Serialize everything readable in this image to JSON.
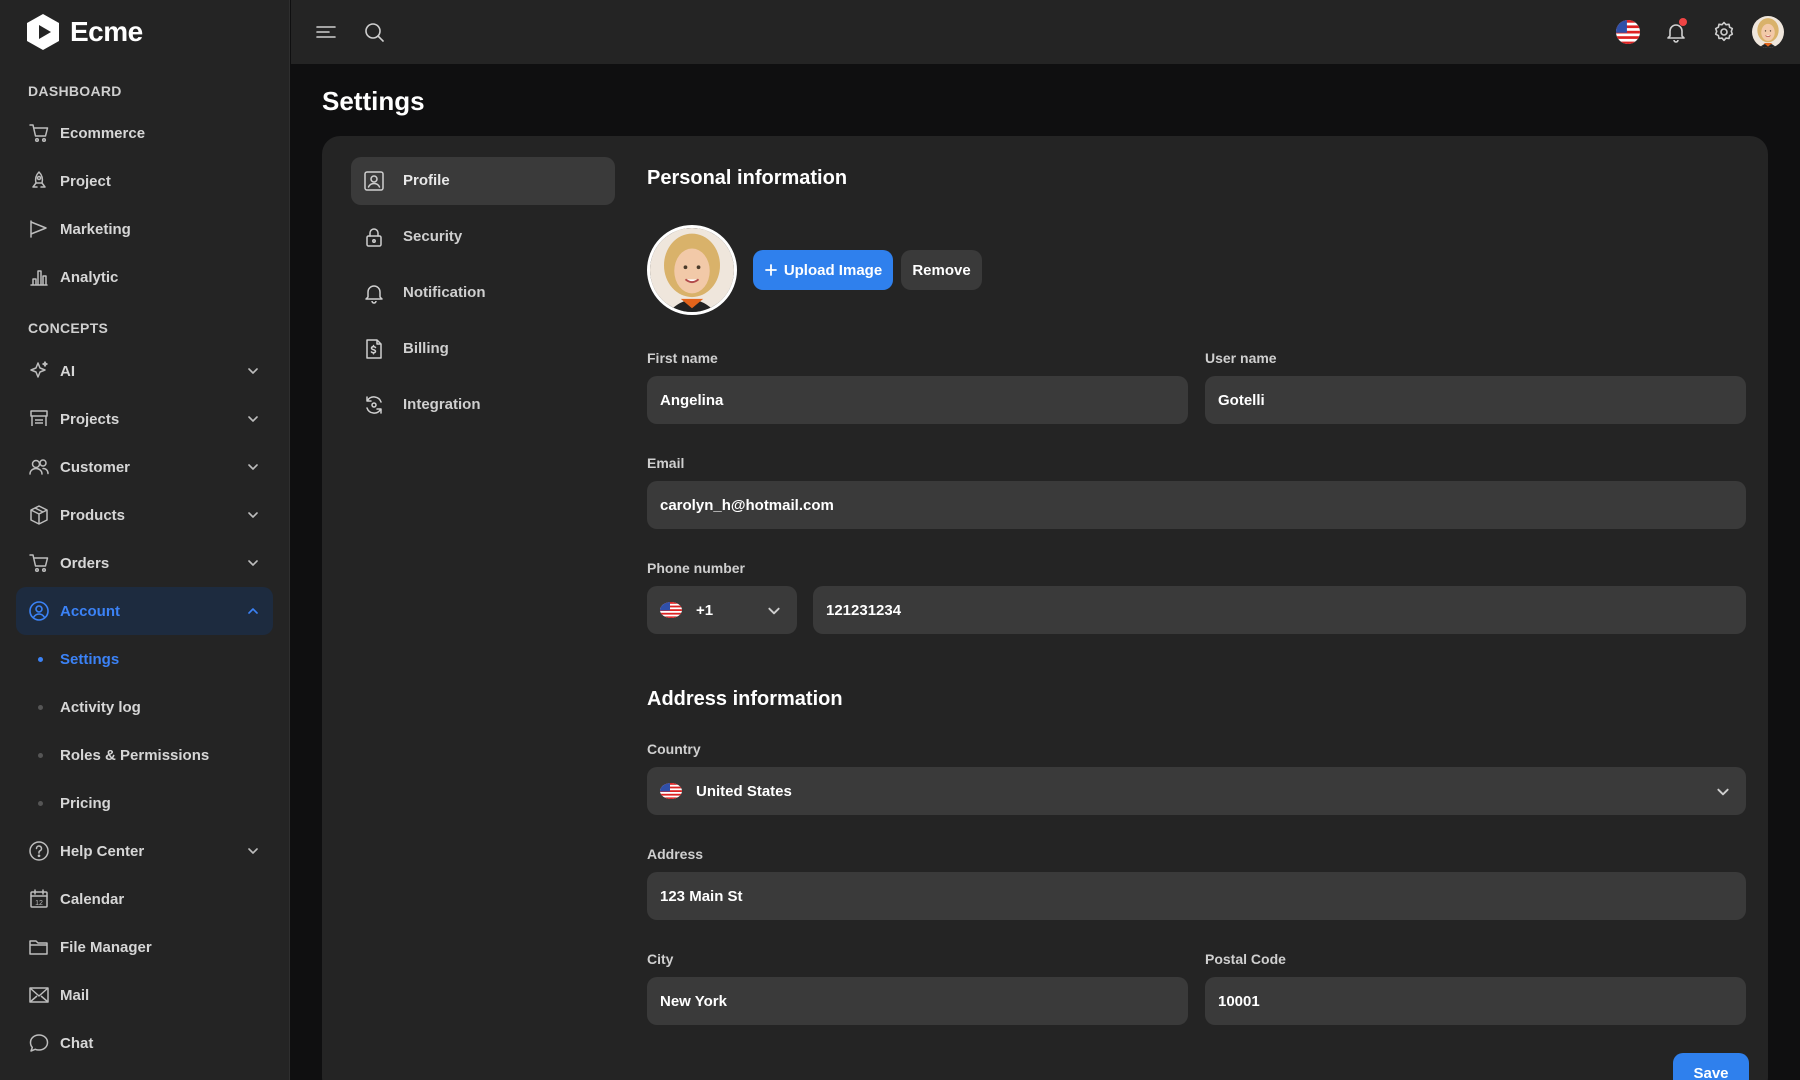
{
  "app": {
    "name": "Ecme"
  },
  "sidebar": {
    "section_dashboard": "DASHBOARD",
    "section_concepts": "CONCEPTS",
    "dashboard_items": [
      {
        "label": "Ecommerce",
        "icon": "cart-icon"
      },
      {
        "label": "Project",
        "icon": "rocket-icon"
      },
      {
        "label": "Marketing",
        "icon": "megaphone-icon"
      },
      {
        "label": "Analytic",
        "icon": "bar-chart-icon"
      }
    ],
    "concept_items": [
      {
        "label": "AI",
        "icon": "sparkle-icon"
      },
      {
        "label": "Projects",
        "icon": "kanban-icon"
      },
      {
        "label": "Customer",
        "icon": "users-icon"
      },
      {
        "label": "Products",
        "icon": "box-icon"
      },
      {
        "label": "Orders",
        "icon": "cart-icon"
      },
      {
        "label": "Account",
        "icon": "user-circle-icon"
      }
    ],
    "account_sub_items": [
      {
        "label": "Settings",
        "active": true
      },
      {
        "label": "Activity log"
      },
      {
        "label": "Roles & Permissions"
      },
      {
        "label": "Pricing"
      }
    ],
    "other_items": [
      {
        "label": "Help Center",
        "icon": "help-circle-icon"
      },
      {
        "label": "Calendar",
        "icon": "calendar-icon",
        "calendar_day": "12"
      },
      {
        "label": "File Manager",
        "icon": "folder-icon"
      },
      {
        "label": "Mail",
        "icon": "mail-icon"
      },
      {
        "label": "Chat",
        "icon": "chat-icon"
      }
    ]
  },
  "page": {
    "title": "Settings"
  },
  "tabs": [
    {
      "label": "Profile",
      "active": true
    },
    {
      "label": "Security"
    },
    {
      "label": "Notification"
    },
    {
      "label": "Billing"
    },
    {
      "label": "Integration"
    }
  ],
  "profile": {
    "personal_heading": "Personal information",
    "upload_button": "Upload Image",
    "remove_button": "Remove",
    "first_name_label": "First name",
    "first_name_value": "Angelina",
    "user_name_label": "User name",
    "user_name_value": "Gotelli",
    "email_label": "Email",
    "email_value": "carolyn_h@hotmail.com",
    "phone_label": "Phone number",
    "dial_code": "+1",
    "phone_value": "121231234",
    "address_heading": "Address information",
    "country_label": "Country",
    "country_value": "United States",
    "address_label": "Address",
    "address_value": "123 Main St",
    "city_label": "City",
    "city_value": "New York",
    "postal_label": "Postal Code",
    "postal_value": "10001",
    "save_button": "Save"
  },
  "colors": {
    "accent": "#2f80ed",
    "active_nav": "#3b82f6",
    "notification": "#ef4444"
  }
}
